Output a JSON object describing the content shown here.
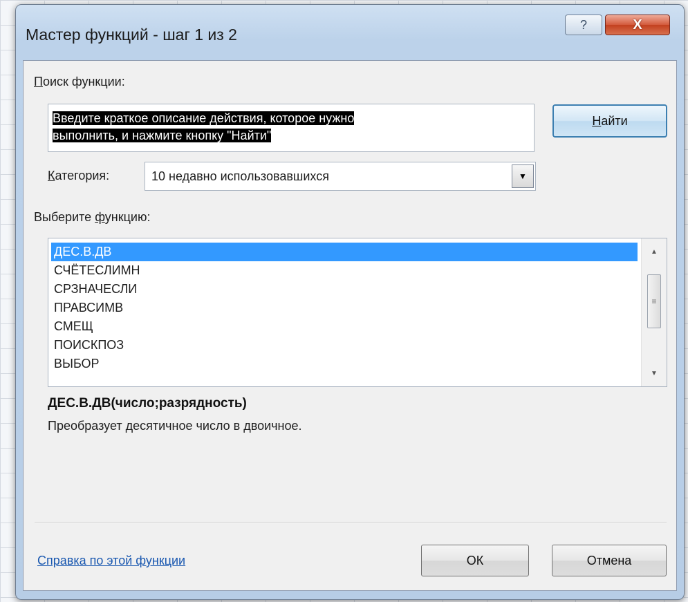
{
  "window": {
    "title": "Мастер функций - шаг 1 из 2",
    "help_glyph": "?",
    "close_glyph": "X"
  },
  "search": {
    "label_prefix": "",
    "label_underlined": "П",
    "label_rest": "оиск функции:",
    "line1": "Введите краткое описание действия, которое нужно",
    "line2": "выполнить, и нажмите кнопку \"Найти\"",
    "find_button_underlined": "Н",
    "find_button_rest": "айти"
  },
  "category": {
    "label_underlined": "К",
    "label_rest": "атегория:",
    "value": "10 недавно использовавшихся"
  },
  "functions": {
    "label_prefix": "Выберите ",
    "label_underlined": "ф",
    "label_rest": "ункцию:",
    "items": [
      "ДЕС.В.ДВ",
      "СЧЁТЕСЛИМН",
      "СРЗНАЧЕСЛИ",
      "ПРАВСИМВ",
      "СМЕЩ",
      "ПОИСКПОЗ",
      "ВЫБОР"
    ],
    "selected_index": 0
  },
  "selected_function": {
    "signature": "ДЕС.В.ДВ(число;разрядность)",
    "description": "Преобразует десятичное число в двоичное."
  },
  "footer": {
    "help_link": "Справка по этой функции",
    "ok_label": "ОК",
    "cancel_label": "Отмена"
  },
  "colors": {
    "selection": "#3399ff",
    "link": "#1a58b0",
    "close_button": "#c2401f"
  }
}
